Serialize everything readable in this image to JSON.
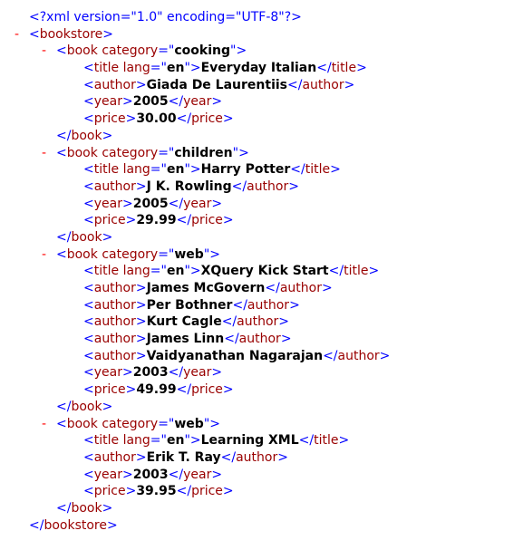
{
  "prolog": "<?xml version=\"1.0\" encoding=\"UTF-8\"?>",
  "toggle_symbol": "-",
  "root_tag": "bookstore",
  "books": [
    {
      "category": "cooking",
      "title": {
        "lang": "en",
        "text": "Everyday Italian"
      },
      "authors": [
        "Giada De Laurentiis"
      ],
      "year": "2005",
      "price": "30.00"
    },
    {
      "category": "children",
      "title": {
        "lang": "en",
        "text": "Harry Potter"
      },
      "authors": [
        "J K. Rowling"
      ],
      "year": "2005",
      "price": "29.99"
    },
    {
      "category": "web",
      "title": {
        "lang": "en",
        "text": "XQuery Kick Start"
      },
      "authors": [
        "James McGovern",
        "Per Bothner",
        "Kurt Cagle",
        "James Linn",
        "Vaidyanathan Nagarajan"
      ],
      "year": "2003",
      "price": "49.99"
    },
    {
      "category": "web",
      "title": {
        "lang": "en",
        "text": "Learning XML"
      },
      "authors": [
        "Erik T. Ray"
      ],
      "year": "2003",
      "price": "39.95"
    }
  ],
  "colors": {
    "bracket": "#0000ff",
    "tag": "#990000",
    "toggle": "#ff0000",
    "text": "#000000"
  }
}
